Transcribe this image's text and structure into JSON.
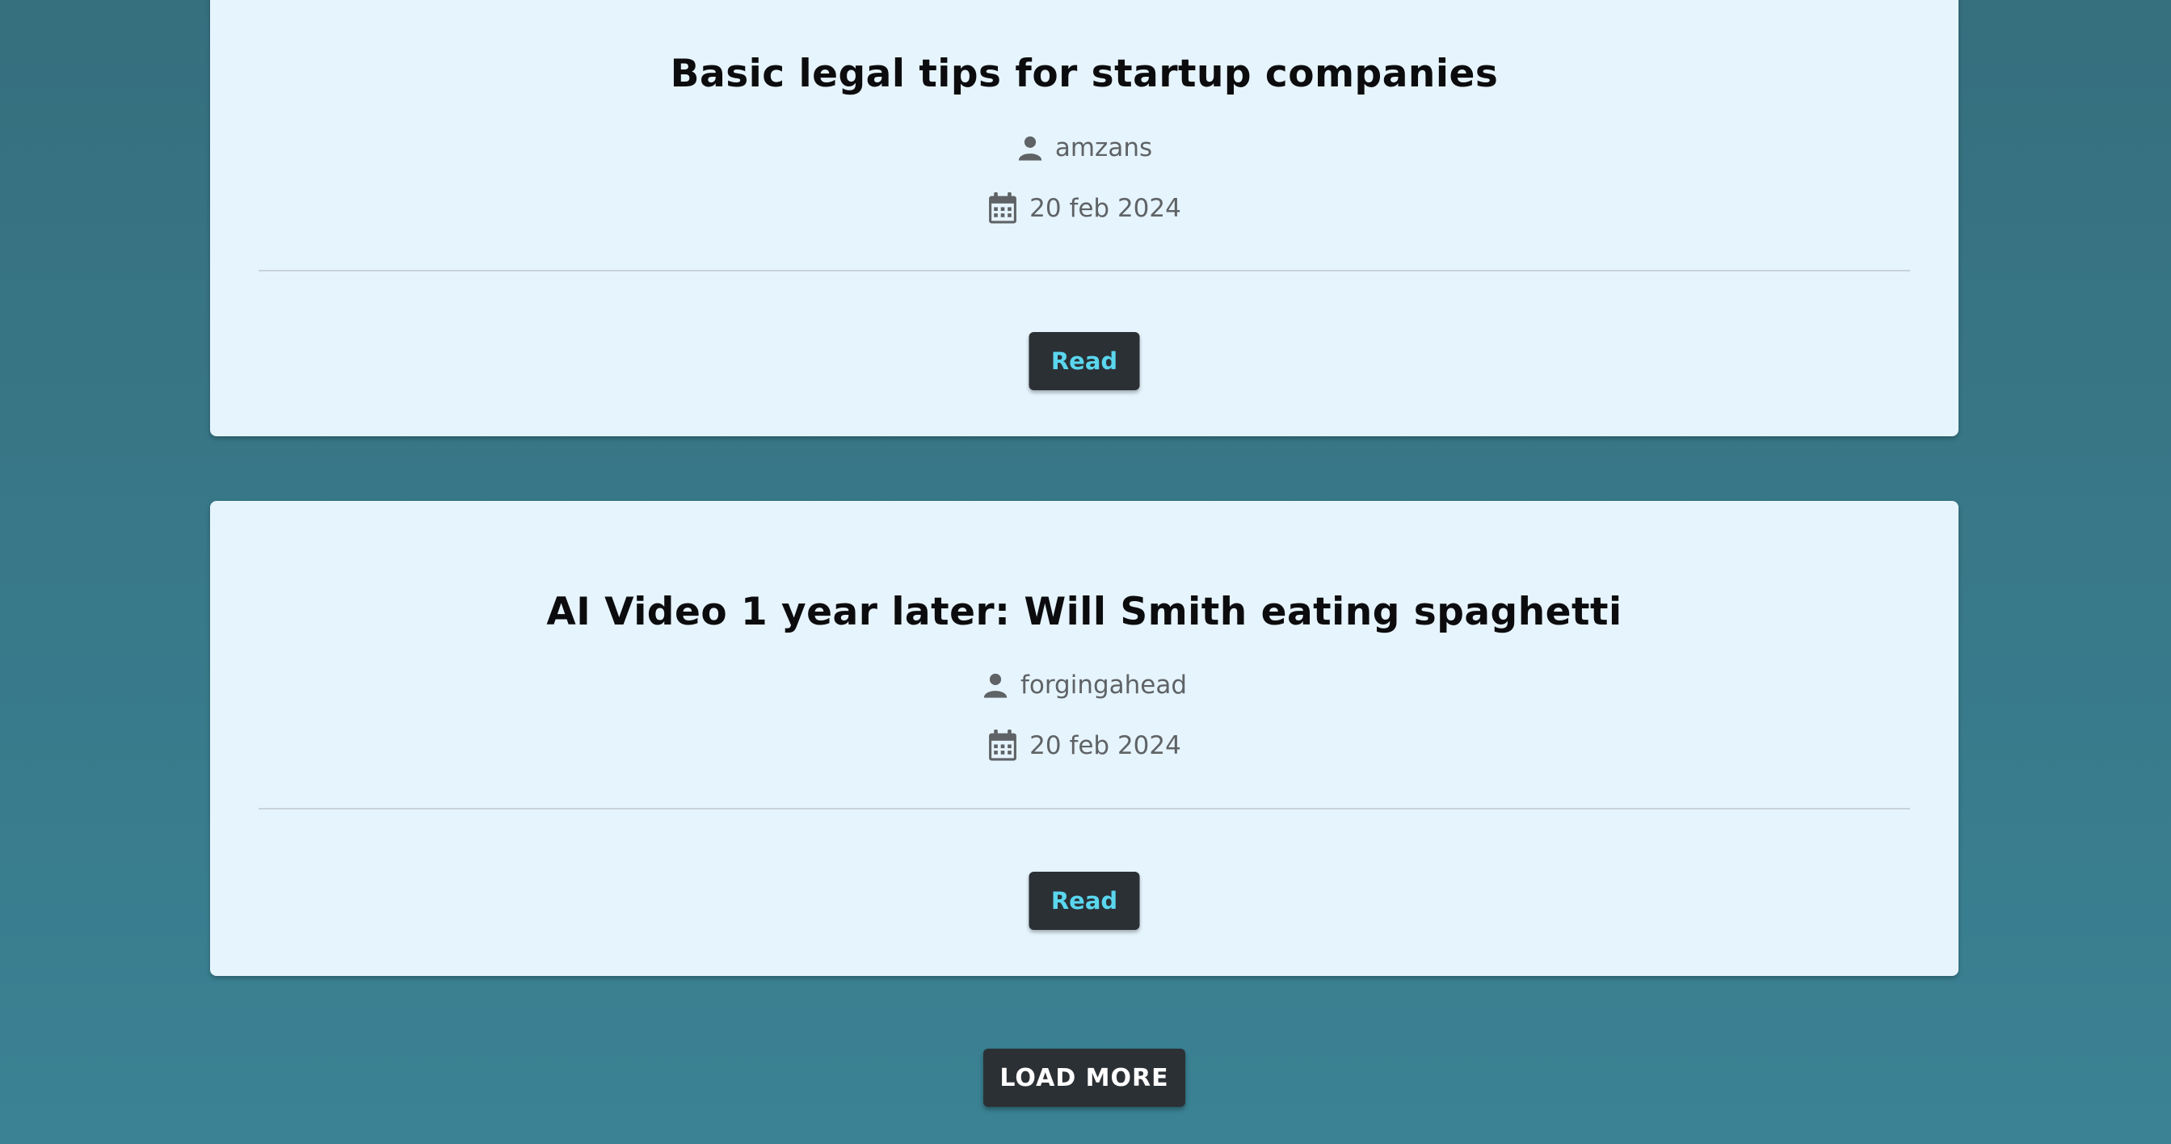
{
  "posts": [
    {
      "title": "Basic legal tips for startup companies",
      "author": "amzans",
      "date": "20 feb 2024",
      "read_label": "Read"
    },
    {
      "title": "AI Video 1 year later: Will Smith eating spaghetti",
      "author": "forgingahead",
      "date": "20 feb 2024",
      "read_label": "Read"
    }
  ],
  "load_more_label": "LOAD MORE",
  "icons": {
    "author": "user-icon",
    "date": "calendar-icon"
  },
  "colors": {
    "background": "#3a7a8b",
    "card": "#e6f4fd",
    "button_bg": "#2b3035",
    "read_text": "#5ad6ee",
    "meta_text": "#5f6366"
  }
}
